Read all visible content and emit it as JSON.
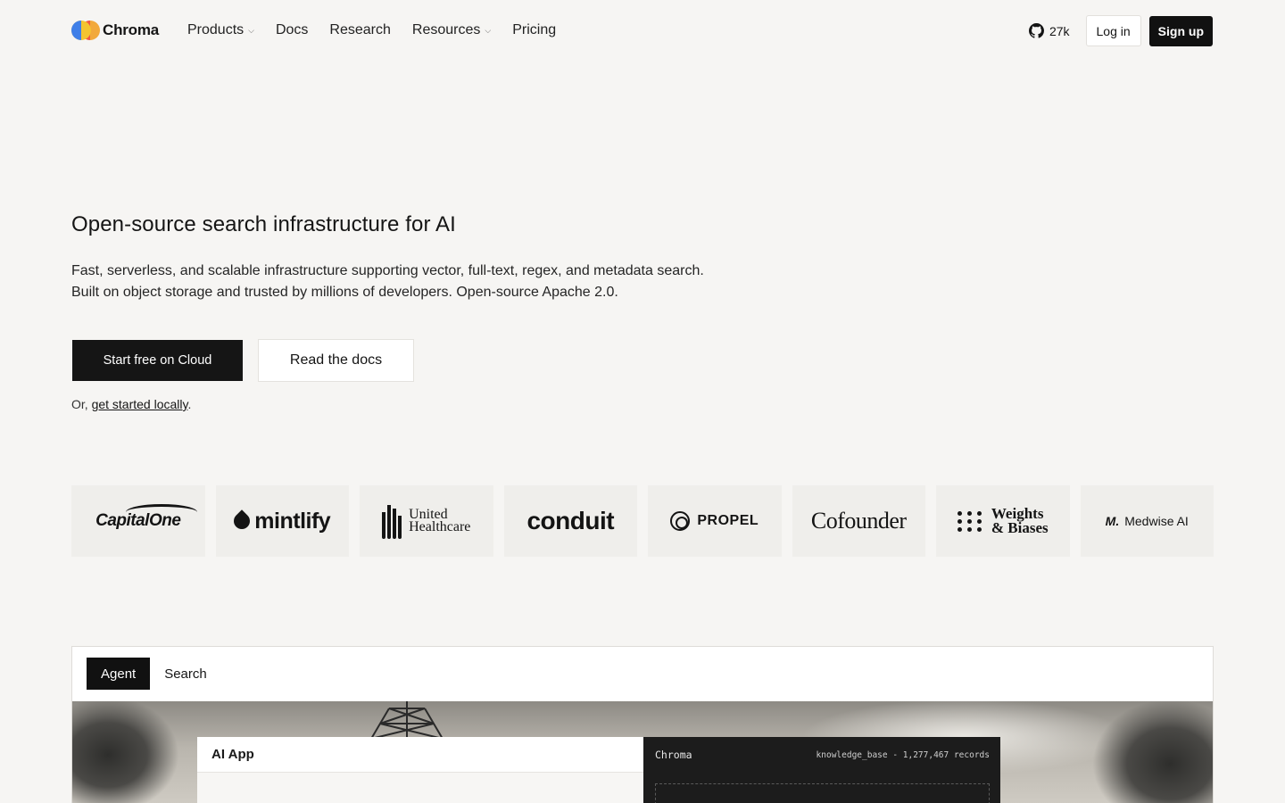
{
  "nav": {
    "brand": "Chroma",
    "links": [
      {
        "label": "Products",
        "dropdown": true
      },
      {
        "label": "Docs",
        "dropdown": false
      },
      {
        "label": "Research",
        "dropdown": false
      },
      {
        "label": "Resources",
        "dropdown": true
      },
      {
        "label": "Pricing",
        "dropdown": false
      }
    ],
    "github_stars": "27k",
    "login": "Log in",
    "signup": "Sign up"
  },
  "hero": {
    "title": "Open-source search infrastructure for AI",
    "subtitle": "Fast, serverless, and scalable infrastructure supporting vector, full-text, regex, and metadata search. Built on object storage and trusted by millions of developers. Open-source Apache 2.0.",
    "cta_primary": "Start free on Cloud",
    "cta_secondary": "Read the docs",
    "local_prefix": "Or, ",
    "local_link": "get started locally",
    "local_suffix": "."
  },
  "logos": {
    "capital_one": "CapitalOne",
    "mintlify": "mintlify",
    "uh_line1": "United",
    "uh_line2": "Healthcare",
    "conduit": "conduit",
    "propel": "PROPEL",
    "cofounder": "Cofounder",
    "wb_line1": "Weights",
    "wb_line2": "& Biases",
    "medwise_mark": "M.",
    "medwise": "Medwise AI"
  },
  "demo": {
    "tabs": [
      {
        "label": "Agent",
        "active": true
      },
      {
        "label": "Search",
        "active": false
      }
    ],
    "ai_app_title": "AI App",
    "db_title": "Chroma",
    "db_meta": "knowledge_base - 1,277,467 records"
  },
  "colors": {
    "background": "#f6f5f3",
    "primary_button": "#151515",
    "logo_card": "#efeeeb"
  },
  "icons": {
    "github": "github-icon",
    "dropdown": "chevron-down-icon"
  }
}
